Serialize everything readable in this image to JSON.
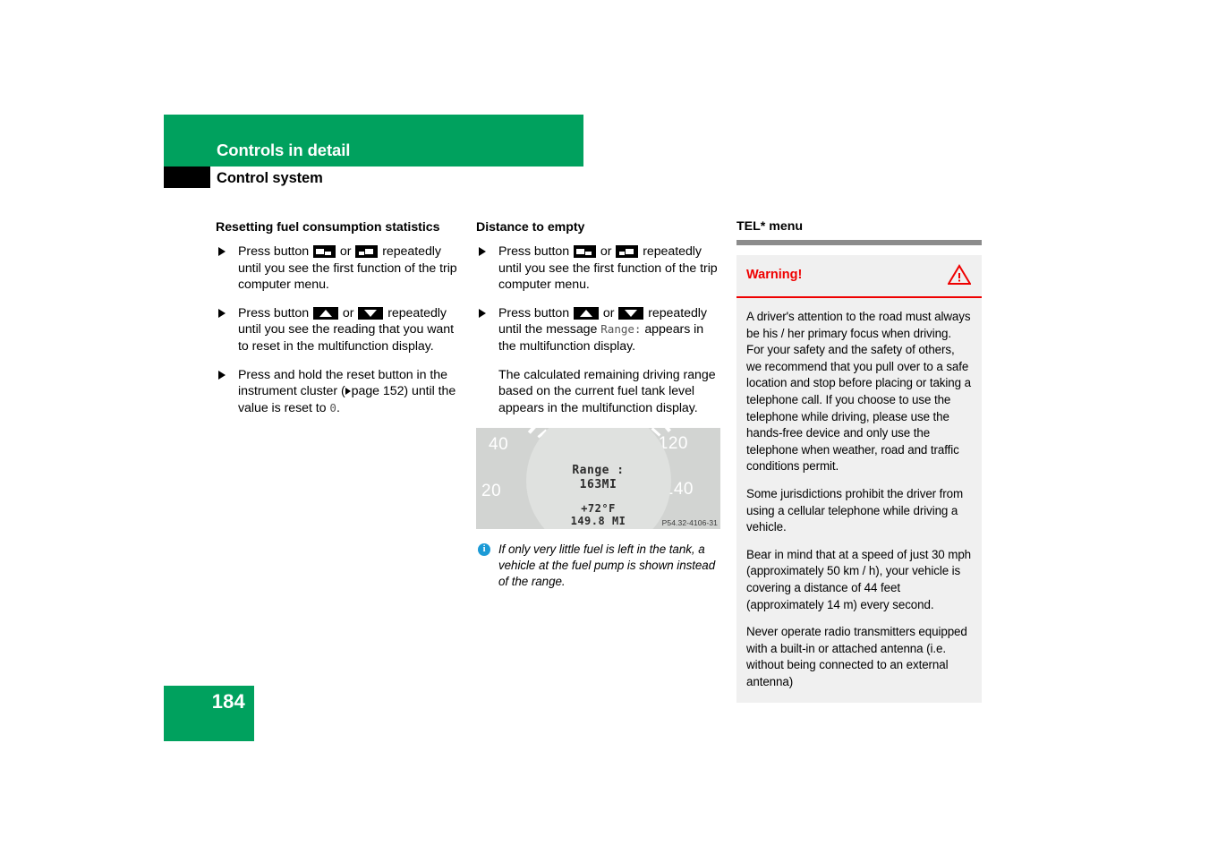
{
  "header": {
    "chapter_title": "Controls in detail",
    "section_title": "Control system",
    "banner_color": "#00a15e"
  },
  "columns": {
    "left": {
      "heading": "Resetting fuel consumption statistics",
      "steps": [
        {
          "text_before": "Press button",
          "icon_a": "window-back-button-icon",
          "text_mid": "or",
          "icon_b": "window-forward-button-icon",
          "text_after": "repeatedly until you see the first function of the trip computer menu."
        },
        {
          "text_before": "Press button",
          "icon_a": "arrow-up-button-icon",
          "text_mid": "or",
          "icon_b": "arrow-down-button-icon",
          "text_after": "repeatedly until you see the reading that you want to reset in the multifunction display."
        },
        {
          "text_before": "Press and hold the reset button in the instrument cluster (",
          "ref_icon": "reference-triangle-icon",
          "ref_text": "page 152",
          "text_after": ") until the value is reset to ",
          "mono_value": "0",
          "text_end": "."
        }
      ]
    },
    "middle": {
      "heading": "Distance to empty",
      "steps": [
        {
          "text_before": "Press button",
          "icon_a": "window-back-button-icon",
          "text_mid": "or",
          "icon_b": "window-forward-button-icon",
          "text_after": "repeatedly until you see the first function of the trip computer menu."
        },
        {
          "text_before": "Press button",
          "icon_a": "arrow-up-button-icon",
          "text_mid": "or",
          "icon_b": "arrow-down-button-icon",
          "text_after_1": "repeatedly until the message ",
          "mono_value": "Range:",
          "text_after_2": " appears in the multifunction display."
        }
      ],
      "paragraph": "The calculated remaining driving range based on the current fuel tank level appears in the multifunction display.",
      "figure": {
        "dial_numbers": [
          "40",
          "20",
          "120",
          "140"
        ],
        "lcd_range_label": "Range :",
        "lcd_range_value": "163MI",
        "lcd_temperature": "+72°F",
        "lcd_odometer": "149.8 MI",
        "figure_code": "P54.32-4106-31"
      },
      "note": {
        "icon": "info-icon",
        "icon_glyph": "i",
        "text": "If only very little fuel is left in the tank, a vehicle at the fuel pump is shown instead of the range."
      }
    },
    "right": {
      "heading": "TEL* menu",
      "warning": {
        "title": "Warning!",
        "title_color": "#ef0000",
        "icon": "warning-triangle-icon",
        "paragraphs": [
          "A driver's attention to the road must always be his / her primary focus when driving. For your safety and the safety of others, we recommend that you pull over to a safe location and stop before placing or taking a telephone call. If you choose to use the telephone while driving, please use the hands-free device and only use the telephone when weather, road and traffic conditions permit.",
          "Some jurisdictions prohibit the driver from using a cellular telephone while driving a vehicle.",
          "Bear in mind that at a speed of just 30 mph (approximately 50 km / h), your vehicle is covering a distance of 44 feet (approximately 14 m) every second.",
          "Never operate radio transmitters equipped with a built-in or attached antenna (i.e. without being connected to an external antenna)"
        ]
      }
    }
  },
  "footer": {
    "page_number": "184"
  }
}
